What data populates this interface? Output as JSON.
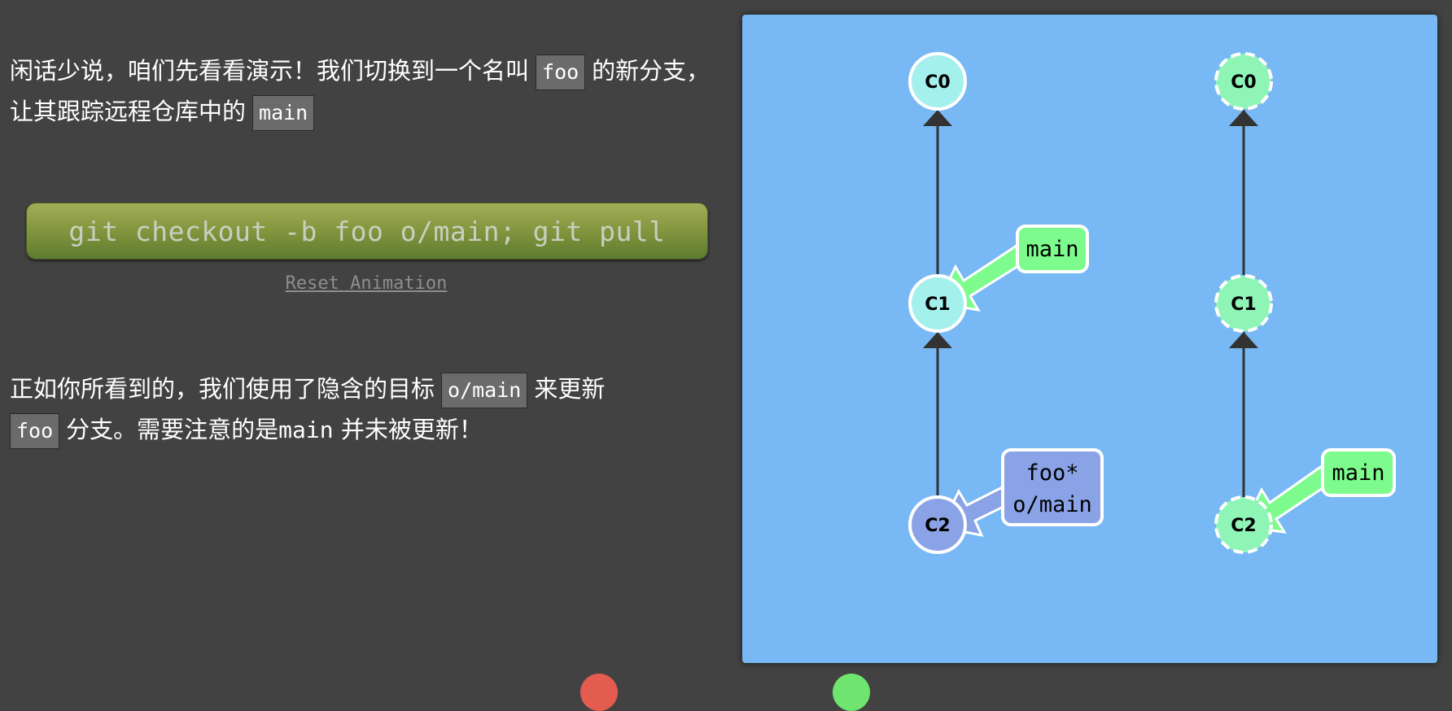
{
  "intro": {
    "part1": "闲话少说，咱们先看看演示！我们切换到一个名叫",
    "code1": "foo",
    "part2": "的新分支，让其跟踪远程仓库中的",
    "code2": "main"
  },
  "command": {
    "label": "git checkout -b foo o/main; git pull"
  },
  "reset": {
    "label": "Reset Animation"
  },
  "outro": {
    "part1": "正如你所看到的，我们使用了隐含的目标",
    "code1": "o/main",
    "part2": "来更新",
    "code2": "foo",
    "part3": "分支。需要注意的是",
    "mono1": "main",
    "part4": "并未被更新！"
  },
  "graph": {
    "local": {
      "commits": [
        "C0",
        "C1",
        "C2"
      ],
      "branch_main": "main",
      "branch_foo": "foo*",
      "branch_origin_main": "o/main"
    },
    "remote": {
      "commits": [
        "C0",
        "C1",
        "C2"
      ],
      "branch_main": "main"
    }
  },
  "colors": {
    "background": "#424242",
    "viz_background": "#78b8f4",
    "commit_local": "#a3f0ec",
    "commit_head": "#8aa2e6",
    "commit_remote": "#8ff5b6",
    "branch_main": "#7dfc8d",
    "branch_foo": "#8aa2e6",
    "dot_left": "#e45b4f",
    "dot_right": "#6fe56f"
  }
}
